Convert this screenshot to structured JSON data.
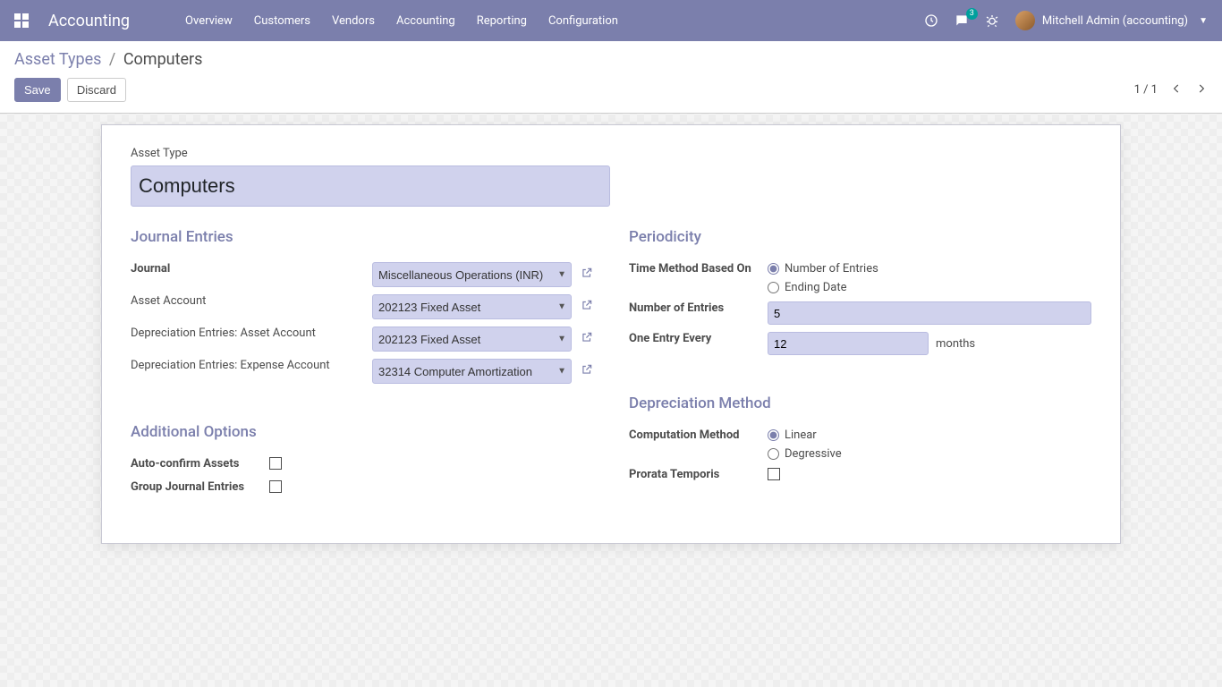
{
  "navbar": {
    "brand": "Accounting",
    "menu": [
      "Overview",
      "Customers",
      "Vendors",
      "Accounting",
      "Reporting",
      "Configuration"
    ],
    "chat_badge": "3",
    "user_name": "Mitchell Admin (accounting)"
  },
  "breadcrumb": {
    "parent": "Asset Types",
    "current": "Computers"
  },
  "buttons": {
    "save": "Save",
    "discard": "Discard"
  },
  "pager": "1 / 1",
  "title": {
    "label": "Asset Type",
    "value": "Computers"
  },
  "sections": {
    "journal_entries": "Journal Entries",
    "periodicity": "Periodicity",
    "additional_options": "Additional Options",
    "depreciation_method": "Depreciation Method"
  },
  "journal_entries": {
    "journal_label": "Journal",
    "journal_value": "Miscellaneous Operations (INR)",
    "asset_account_label": "Asset Account",
    "asset_account_value": "202123 Fixed Asset",
    "dep_asset_label": "Depreciation Entries: Asset Account",
    "dep_asset_value": "202123 Fixed Asset",
    "dep_expense_label": "Depreciation Entries: Expense Account",
    "dep_expense_value": "32314 Computer Amortization"
  },
  "periodicity": {
    "time_method_label": "Time Method Based On",
    "time_method_options": [
      "Number of Entries",
      "Ending Date"
    ],
    "time_method_selected": "Number of Entries",
    "number_entries_label": "Number of Entries",
    "number_entries_value": "5",
    "one_entry_label": "One Entry Every",
    "one_entry_value": "12",
    "one_entry_unit": "months"
  },
  "additional_options": {
    "auto_confirm_label": "Auto-confirm Assets",
    "group_journal_label": "Group Journal Entries"
  },
  "depreciation_method": {
    "computation_label": "Computation Method",
    "computation_options": [
      "Linear",
      "Degressive"
    ],
    "computation_selected": "Linear",
    "prorata_label": "Prorata Temporis"
  }
}
